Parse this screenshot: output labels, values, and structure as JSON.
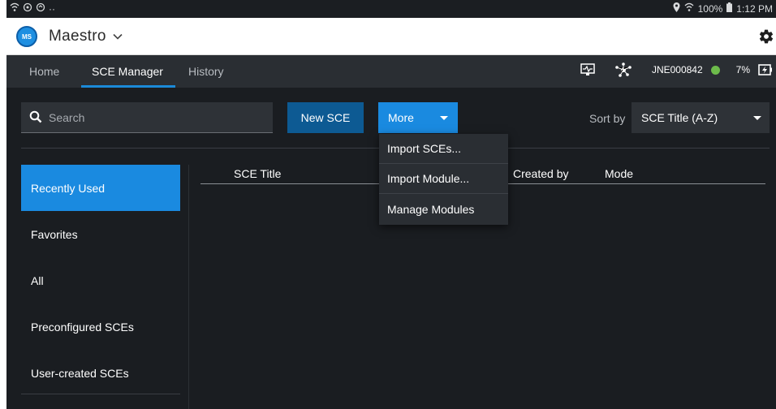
{
  "status_bar": {
    "right_text": "100%",
    "time": "1:12 PM"
  },
  "app": {
    "logo_text": "MS",
    "title": "Maestro"
  },
  "nav": {
    "tabs": [
      {
        "label": "Home",
        "active": false
      },
      {
        "label": "SCE Manager",
        "active": true
      },
      {
        "label": "History",
        "active": false
      }
    ],
    "device_id": "JNE000842",
    "battery": "7%"
  },
  "toolbar": {
    "search_placeholder": "Search",
    "new_label": "New SCE",
    "more_label": "More",
    "sort_label": "Sort by",
    "sort_value": "SCE Title (A-Z)"
  },
  "sidebar": {
    "items": [
      {
        "label": "Recently Used",
        "active": true
      },
      {
        "label": "Favorites",
        "active": false
      },
      {
        "label": "All",
        "active": false
      },
      {
        "label": "Preconfigured SCEs",
        "active": false
      },
      {
        "label": "User-created SCEs",
        "active": false
      }
    ]
  },
  "table": {
    "columns": [
      "SCE Title",
      "Created by",
      "Mode"
    ]
  },
  "more_menu": {
    "items": [
      "Import SCEs...",
      "Import Module...",
      "Manage Modules"
    ]
  },
  "colors": {
    "accent": "#1a8ae0",
    "button_dark_blue": "#0d5a93",
    "content_bg": "#1a1d21",
    "navbar_bg": "#2a2e33",
    "status_ok": "#6dbb4b"
  }
}
